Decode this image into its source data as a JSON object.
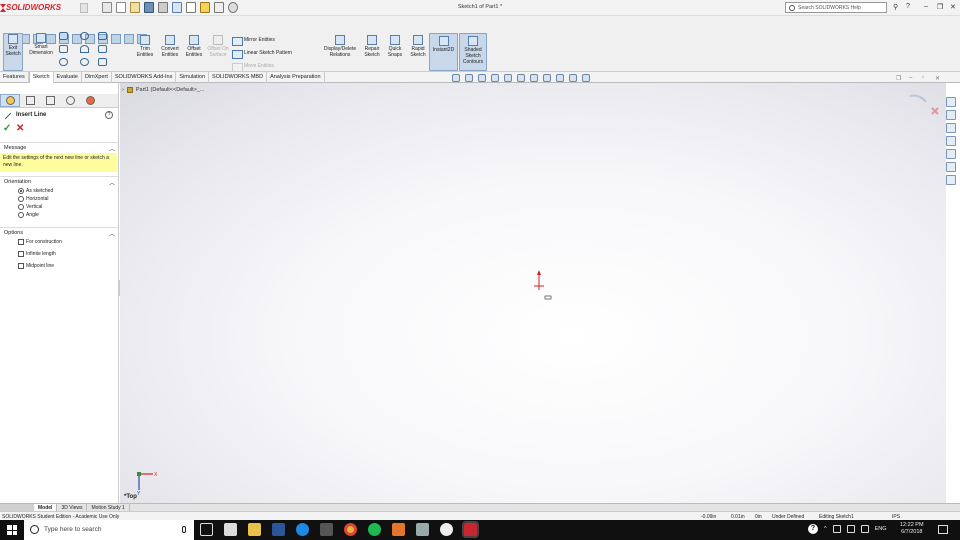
{
  "app": {
    "logo": "SOLIDWORKS",
    "document_title": "Sketch1 of Part1 *",
    "search_placeholder": "Search SOLIDWORKS Help"
  },
  "ribbon": {
    "commands": [
      {
        "label": "Exit Sketch",
        "state": "active"
      },
      {
        "label": "Smart Dimension",
        "state": "normal"
      },
      {
        "label": "Trim Entities",
        "state": "normal"
      },
      {
        "label": "Convert Entities",
        "state": "normal"
      },
      {
        "label": "Offset Entities",
        "state": "normal"
      },
      {
        "label": "Offset On Surface",
        "state": "disabled"
      },
      {
        "label": "Display/Delete Relations",
        "state": "normal"
      },
      {
        "label": "Repair Sketch",
        "state": "normal"
      },
      {
        "label": "Quick Snaps",
        "state": "normal"
      },
      {
        "label": "Rapid Sketch",
        "state": "normal"
      },
      {
        "label": "Instant2D",
        "state": "active"
      },
      {
        "label": "Shaded Sketch Contours",
        "state": "active"
      }
    ],
    "pattern_tools": [
      "Mirror Entities",
      "Linear Sketch Pattern",
      "Move Entities"
    ]
  },
  "tabs": [
    "Features",
    "Sketch",
    "Evaluate",
    "DimXpert",
    "SOLIDWORKS Add-Ins",
    "Simulation",
    "SOLIDWORKS MBD",
    "Analysis Preparation"
  ],
  "active_tab": "Sketch",
  "property_manager": {
    "title": "Insert Line",
    "message_header": "Message",
    "message_text": "Edit the settings of the next new line or sketch a new line.",
    "orientation_header": "Orientation",
    "orientation_options": [
      "As sketched",
      "Horizontal",
      "Vertical",
      "Angle"
    ],
    "orientation_selected": "As sketched",
    "options_header": "Options",
    "options": [
      "For construction",
      "Infinite length",
      "Midpoint line"
    ]
  },
  "feature_tree": {
    "root": "Part1  (Default<<Default>_..."
  },
  "viewport": {
    "orientation": "*Top",
    "triad_x": "X",
    "triad_y": "Y"
  },
  "bottom_tabs": [
    "Model",
    "3D Views",
    "Motion Study 1"
  ],
  "active_bottom_tab": "Model",
  "status": {
    "edition": "SOLIDWORKS Student Edition - Academic Use Only",
    "x": "-0.09in",
    "y": "0.01in",
    "z": "0in",
    "definition": "Under Defined",
    "mode": "Editing Sketch1",
    "units": "IPS"
  },
  "taskbar": {
    "search_placeholder": "Type here to search",
    "language": "ENG",
    "time": "12:22 PM",
    "date": "6/7/2018"
  },
  "colors": {
    "brand_red": "#d8262e",
    "message_yellow": "#fdfd9e",
    "accent_blue": "#587fa8",
    "ok_green": "#2a9a2a",
    "cancel_red": "#c8202a"
  }
}
